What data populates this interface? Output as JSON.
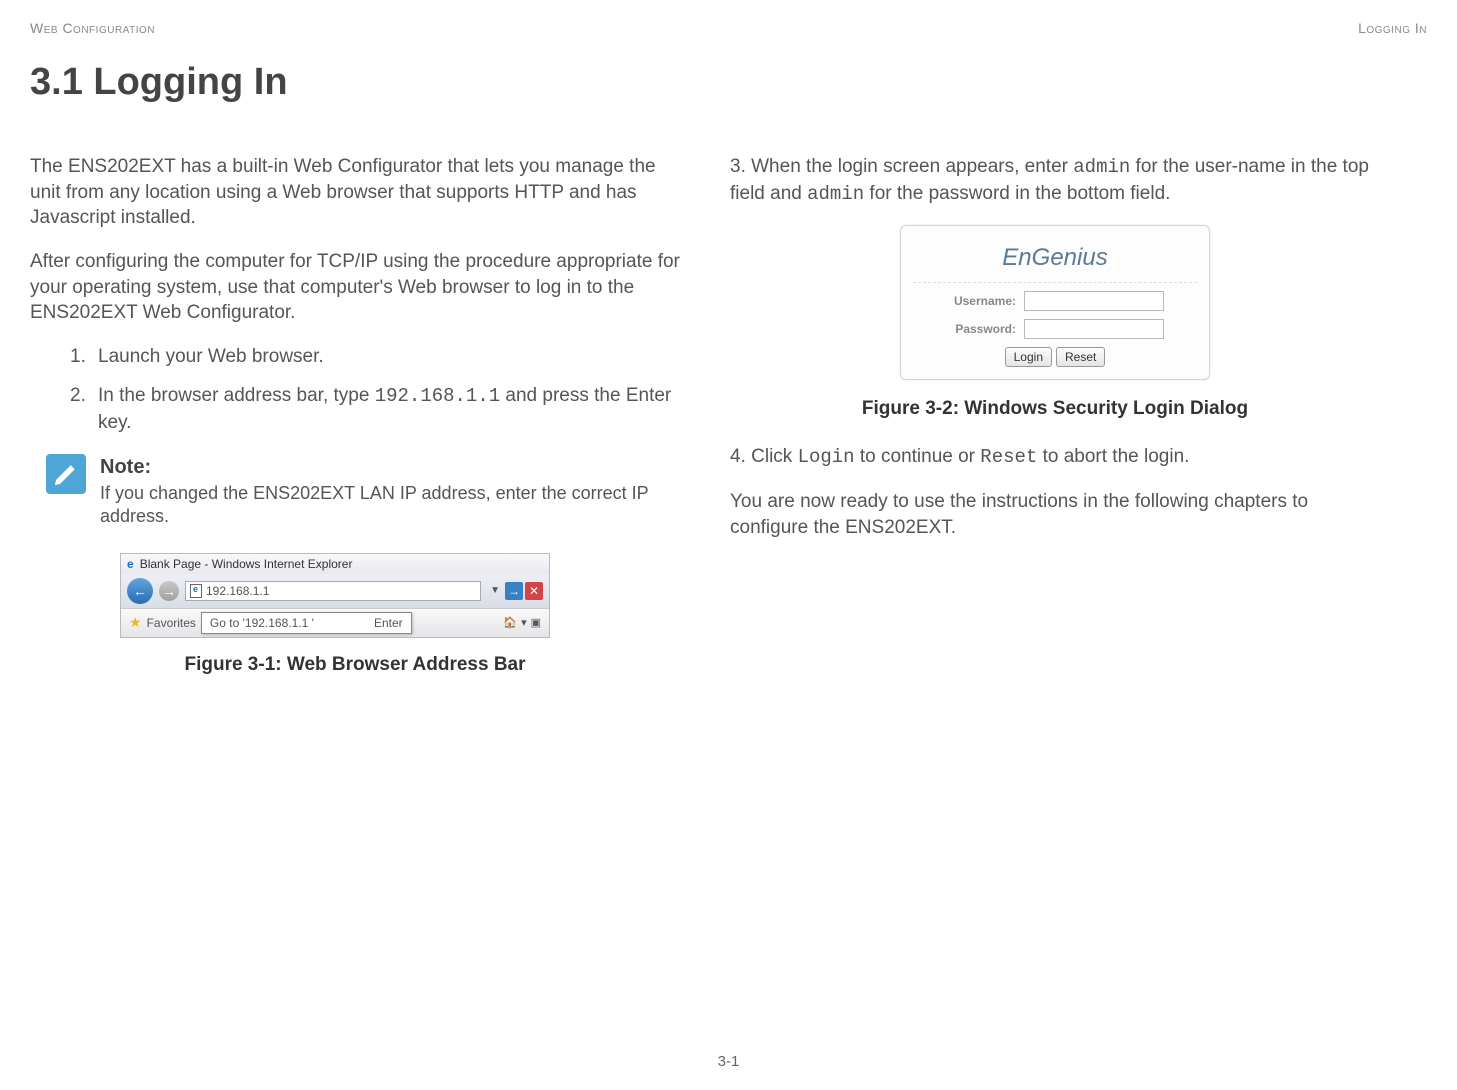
{
  "header": {
    "left": "Web Configuration",
    "right": "Logging In"
  },
  "heading": "3.1 Logging In",
  "left_col": {
    "p1": "The ENS202EXT has a built-in Web Configurator that lets you manage the unit from any location using a Web browser that supports HTTP and has Javascript installed.",
    "p2": "After configuring the computer for TCP/IP using the procedure appropriate for your operating system, use that computer's Web browser to log in to the ENS202EXT Web Configurator.",
    "step1_num": "1.",
    "step1": "Launch your Web browser.",
    "step2_num": "2.",
    "step2_a": "In the browser address bar, type ",
    "step2_code": "192.168.1.1",
    "step2_b": " and press the Enter key.",
    "note_label": "Note:",
    "note_text": "If you changed the ENS202EXT LAN IP address, enter the correct IP address.",
    "ie": {
      "title": "Blank Page - Windows Internet Explorer",
      "url": "192.168.1.1",
      "fav": "Favorites",
      "tooltip_a": "Go to '",
      "tooltip_b": "192.168.1.1",
      "tooltip_c": " '",
      "enter": "Enter"
    },
    "fig1_caption": "Figure 3-1: Web Browser Address Bar"
  },
  "right_col": {
    "p3_a": "3. When the login screen appears, enter ",
    "p3_code1": "admin",
    "p3_b": " for the user-name in the top field and ",
    "p3_code2": "admin",
    "p3_c": " for the password in the bottom field.",
    "login": {
      "brand": "EnGenius",
      "user_label": "Username:",
      "pass_label": "Password:",
      "login_btn": "Login",
      "reset_btn": "Reset"
    },
    "fig2_caption": "Figure 3-2: Windows Security Login Dialog",
    "p4_a": "4. Click ",
    "p4_code1": "Login",
    "p4_b": " to continue or ",
    "p4_code2": "Reset",
    "p4_c": " to abort the login.",
    "p5": "You are now ready to use the instructions in the following chapters to configure the ENS202EXT."
  },
  "page_number": "3-1"
}
